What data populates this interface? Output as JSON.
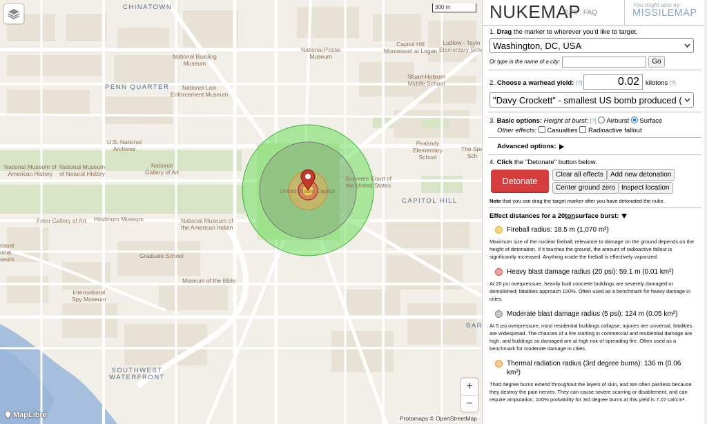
{
  "map": {
    "scale_label": "300 m",
    "attribution": "Protomaps © OpenStreetMap",
    "maplibre_label": "MapLibre",
    "zoom_in": "+",
    "zoom_out": "−",
    "labels": {
      "chinatown": "CHINATOWN",
      "penn_quarter": "PENN QUARTER",
      "capitol_hill": "CAPITOL HILL",
      "southwest_waterfront_1": "SOUTHWEST",
      "southwest_waterfront_2": "WATERFRONT",
      "bar": "BAR",
      "nbm_1": "National Building",
      "nbm_2": "Museum",
      "npm_1": "National Postal",
      "npm_2": "Museum",
      "chm_1": "Capitol Hill",
      "chm_2": "Montessori at Logan",
      "lt_1": "Ludlow - Taylo",
      "lt_2": "Elementary Scho",
      "nlem_1": "National Law",
      "nlem_2": "Enforcement Museum",
      "sh_1": "Stuart-Hobson",
      "sh_2": "Middle School",
      "usna_1": "U.S. National",
      "usna_2": "Archives",
      "pe_1": "Peabody",
      "pe_2": "Elementary",
      "pe_3": "School",
      "sp_1": "The Spe",
      "sp_2": "Sch",
      "nmah_1": "National Museum of",
      "nmah_2": "American History",
      "nmnh_1": "National Museum",
      "nmnh_2": "of Natural History",
      "nga_1": "National",
      "nga_2": "Gallery of Art",
      "usc": "United States Capitol",
      "scus_1": "Supreme Court of",
      "scus_2": "the United States",
      "fga": "Freer Gallery of Art",
      "hm": "Hirshhorn Museum",
      "nmai_1": "National Museum of",
      "nmai_2": "the American Indian",
      "hol_1": "caust",
      "hol_2": "orial",
      "hol_3": "seum",
      "gs": "Graduate School",
      "mob": "Museum of the Bible",
      "ism_1": "International",
      "ism_2": "Spy Museum"
    }
  },
  "panel": {
    "logo": "NUKEMAP",
    "version": "2.75 : FAQ",
    "also_try": "You might also try:",
    "missilemap": "MISSILEMAP",
    "step1": {
      "num": "1.",
      "bold": "Drag",
      "rest": " the marker to wherever you'd like to target.",
      "city": "Washington, DC, USA",
      "type_label": "Or type in the name of a city:",
      "city_input": "",
      "go": "Go"
    },
    "step2": {
      "num": "2.",
      "bold": "Choose a warhead yield:",
      "help": "[?]",
      "yield": "0.02",
      "unit": "kilotons",
      "help2": "[?]",
      "preset": "\"Davy Crockett\" - smallest US bomb produced (20 tons)"
    },
    "step3": {
      "num": "3.",
      "bold": "Basic options:",
      "height_label": "Height of burst:",
      "help": "[?]",
      "airburst": "Airburst",
      "surface": "Surface",
      "other_label": "Other effects:",
      "casualties": "Casualties",
      "fallout": "Radioactive fallout"
    },
    "advanced": "Advanced options:",
    "step4": {
      "num": "4.",
      "bold": "Click",
      "rest": " the \"Detonate\" button below.",
      "detonate": "Detonate",
      "clear": "Clear all effects",
      "add": "Add new detonation",
      "center": "Center ground zero",
      "inspect": "Inspect location"
    },
    "note_bold": "Note",
    "note_rest": " that you can drag the target marker after you have detonated the nuke.",
    "effects_head_1": "Effect distances for a 20 ",
    "effects_head_ton": "ton",
    "effects_head_2": " surface burst:",
    "effects": [
      {
        "color": "#f7d57a",
        "border": "#e0b444",
        "title": "Fireball radius: 18.5 m (1,070 m²)",
        "desc": "Maximum size of the nuclear fireball; relevance to damage on the ground depends on the height of detonation. If it touches the ground, the amount of radioactive fallout is significantly increased. Anything inside the fireball is effectively vaporized."
      },
      {
        "color": "#f5a3a3",
        "border": "#d05050",
        "title": "Heavy blast damage radius (20 psi): 59.1 m (0.01 km²)",
        "desc": "At 20 psi overpressure, heavily built concrete buildings are severely damaged or demolished; fatalities approach 100%. Often used as a benchmark for heavy damage in cities."
      },
      {
        "color": "#c8c8c8",
        "border": "#888888",
        "title": "Moderate blast damage radius (5 psi): 124 m (0.05 km²)",
        "desc": "At 5 psi overpressure, most residential buildings collapse, injuries are universal, fatalities are widespread. The chances of a fire starting in commercial and residential damage are high, and buildings so damaged are at high risk of spreading fire. Often used as a benchmark for moderate damage in cities."
      },
      {
        "color": "#f7c98a",
        "border": "#e09a44",
        "title": "Thermal radiation radius (3rd degree burns): 136 m (0.06 km²)",
        "desc": "Third degree burns extend throughout the layers of skin, and are often painless because they destroy the pain nerves. They can cause severe scarring or disablement, and can require amputation. 100% probability for 3rd degree burns at this yield is 7.07 cal/cm²."
      }
    ]
  }
}
